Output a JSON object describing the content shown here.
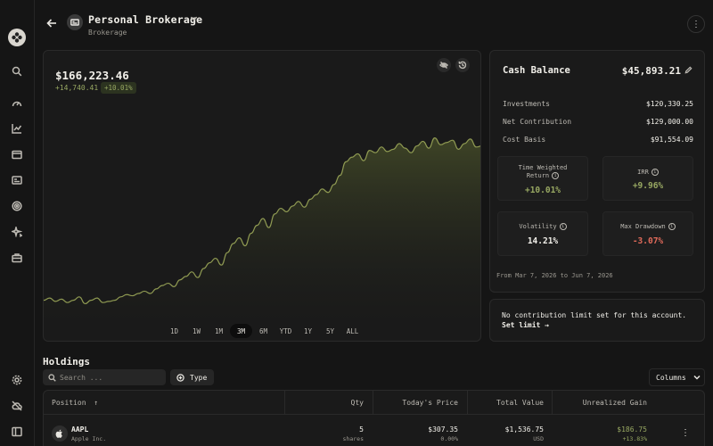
{
  "header": {
    "title": "Personal Brokerage",
    "subtitle": "Brokerage"
  },
  "sidebar": {
    "items": [
      {
        "icon": "search-icon"
      },
      {
        "icon": "gauge-icon"
      },
      {
        "icon": "chart-icon"
      },
      {
        "icon": "wallet-icon"
      },
      {
        "icon": "card-icon"
      },
      {
        "icon": "target-icon"
      },
      {
        "icon": "sparkle-icon"
      },
      {
        "icon": "briefcase-icon"
      }
    ],
    "bottom": [
      {
        "icon": "settings-icon"
      },
      {
        "icon": "cloud-off-icon"
      },
      {
        "icon": "sidebar-toggle-icon"
      }
    ]
  },
  "chart": {
    "total_value": "$166,223.46",
    "gain_abs": "+14,740.41",
    "gain_pct": "+10.01%",
    "ranges": [
      "1D",
      "1W",
      "1M",
      "3M",
      "6M",
      "YTD",
      "1Y",
      "5Y",
      "ALL"
    ],
    "active_range": "3M"
  },
  "chart_data": {
    "type": "area",
    "title": "",
    "xlabel": "",
    "ylabel": "",
    "x_range": [
      "Mar 7, 2026",
      "Jun 7, 2026"
    ],
    "values": [
      152.6,
      152.8,
      152.5,
      152.7,
      152.4,
      152.6,
      152.9,
      152.3,
      152.6,
      152.8,
      152.4,
      152.5,
      152.6,
      152.9,
      153.1,
      153.0,
      153.2,
      153.4,
      153.2,
      153.6,
      153.9,
      154.1,
      153.8,
      154.4,
      154.7,
      155.1,
      154.6,
      155.4,
      155.9,
      156.3,
      155.7,
      156.8,
      157.6,
      158.1,
      157.4,
      158.5,
      159.2,
      159.8,
      159.0,
      160.2,
      160.7,
      160.4,
      160.9,
      161.3,
      160.8,
      161.5,
      161.9,
      162.4,
      162.1,
      162.8,
      163.6,
      164.8,
      165.2,
      165.5,
      164.9,
      165.8,
      165.6,
      166.1,
      165.7,
      165.9,
      166.4,
      166.0,
      165.6,
      166.2,
      166.6,
      166.0,
      166.9,
      166.3,
      166.5,
      166.7,
      165.9,
      166.4,
      166.8,
      166.1,
      166.2
    ],
    "series": [
      {
        "name": "",
        "color": "#8f9a52"
      }
    ]
  },
  "summary": {
    "cash_label": "Cash Balance",
    "cash_value": "$45,893.21",
    "rows": [
      {
        "label": "Investments",
        "value": "$120,330.25"
      },
      {
        "label": "Net Contribution",
        "value": "$129,000.00"
      },
      {
        "label": "Cost Basis",
        "value": "$91,554.09"
      }
    ],
    "metrics": [
      {
        "label": "Time Weighted\nReturn",
        "value": "+10.01%",
        "tone": "pos"
      },
      {
        "label": "IRR",
        "value": "+9.96%",
        "tone": "pos"
      },
      {
        "label": "Volatility",
        "value": "14.21%",
        "tone": "neutral"
      },
      {
        "label": "Max Drawdown",
        "value": "-3.07%",
        "tone": "neg"
      }
    ],
    "period": "From Mar 7, 2026 to Jun 7, 2026"
  },
  "limit": {
    "text": "No contribution limit set for this account.",
    "link": "Set limit →"
  },
  "holdings": {
    "title": "Holdings",
    "search_placeholder": "Search ...",
    "type_label": "Type",
    "columns_label": "Columns",
    "headers": {
      "position": "Position",
      "qty": "Qty",
      "price": "Today's Price",
      "total": "Total Value",
      "gain": "Unrealized Gain"
    },
    "rows": [
      {
        "symbol": "AAPL",
        "name": "Apple Inc.",
        "qty": "5",
        "qty_unit": "shares",
        "price": "$307.35",
        "price_change": "0.00%",
        "total": "$1,536.75",
        "currency": "USD",
        "gain": "$186.75",
        "gain_pct": "+13.83%"
      }
    ]
  },
  "colors": {
    "accent_positive": "#98a862",
    "accent_negative": "#e06a5a",
    "chart_line": "#8f9a52",
    "background": "#151515"
  }
}
